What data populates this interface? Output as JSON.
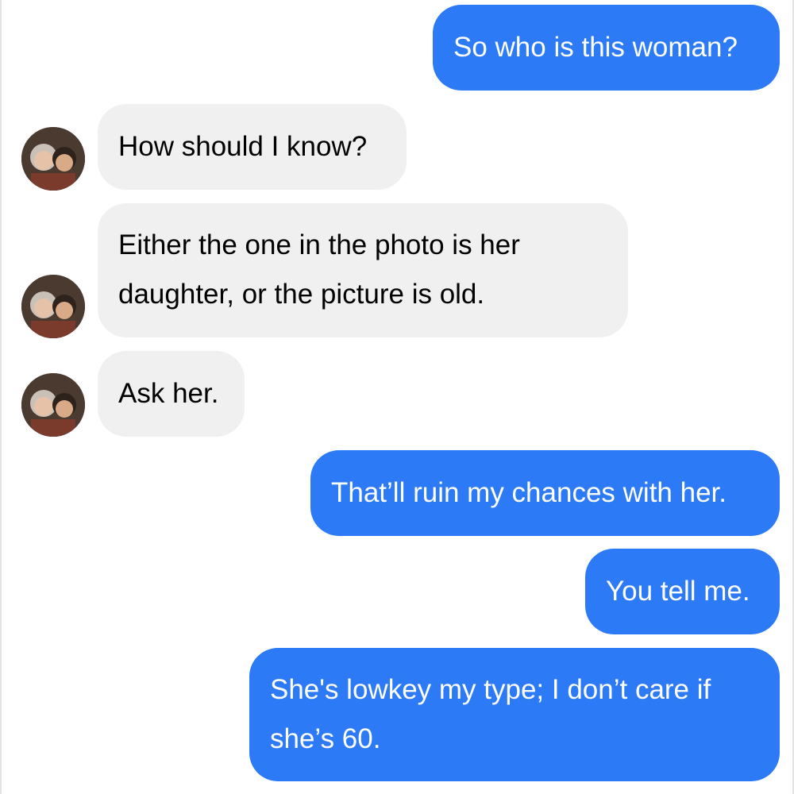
{
  "conversation": {
    "messages": [
      {
        "sender": "me",
        "text": "So who is this woman?"
      },
      {
        "sender": "them",
        "text": "How should I know?"
      },
      {
        "sender": "them",
        "text": "Either the one in the photo is her daughter, or the picture is old."
      },
      {
        "sender": "them",
        "text": "Ask her."
      },
      {
        "sender": "me",
        "text": "That’ll ruin my chances with her."
      },
      {
        "sender": "me",
        "text": "You tell me."
      },
      {
        "sender": "me",
        "text": "She's lowkey my type; I don’t care if she’s 60."
      }
    ],
    "lines": {
      "m2_line1": "Either the one in the photo is her",
      "m2_line2": "daughter, or the picture is old.",
      "m6_line1": "She's lowkey my type; I don’t care if",
      "m6_line2": "she’s 60."
    }
  },
  "colors": {
    "sent_bubble": "#2d7af6",
    "received_bubble": "#f0f0f0",
    "background": "#ffffff"
  },
  "icons": {
    "avatar": "contact-photo-avatar"
  }
}
